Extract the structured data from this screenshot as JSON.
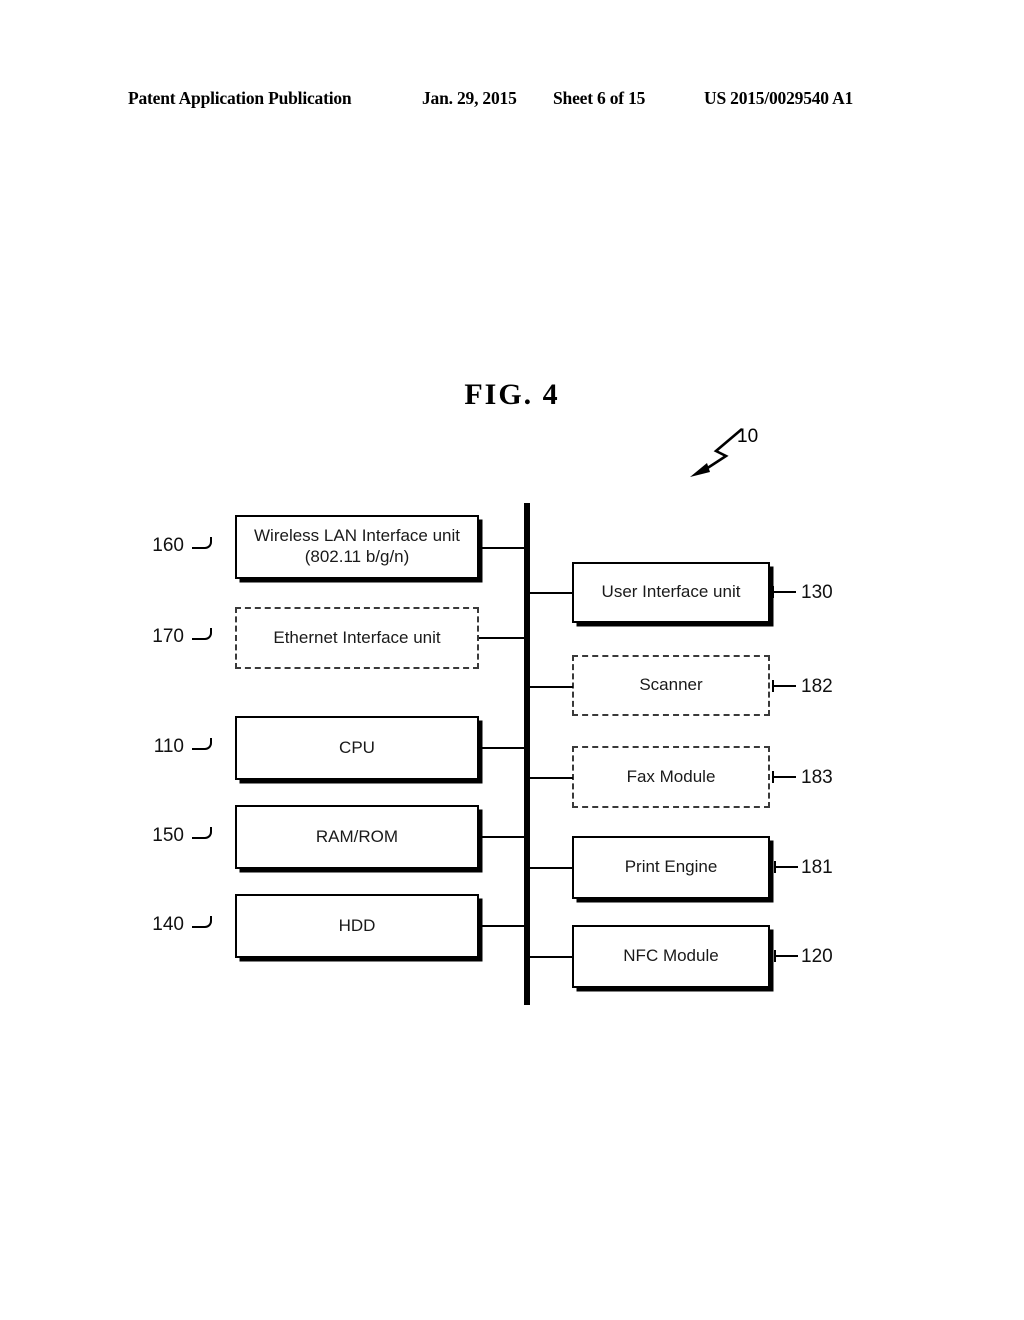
{
  "header": {
    "publication": "Patent Application Publication",
    "date": "Jan. 29, 2015",
    "sheet": "Sheet 6 of 15",
    "document_number": "US 2015/0029540 A1"
  },
  "figure": {
    "title": "FIG.  4",
    "system_ref": "10"
  },
  "diagram": {
    "bus_name": "system-bus",
    "left_blocks": [
      {
        "ref": "160",
        "label": "Wireless LAN Interface unit\n(802.11 b/g/n)",
        "style": "solid"
      },
      {
        "ref": "170",
        "label": "Ethernet Interface unit",
        "style": "dashed"
      },
      {
        "ref": "110",
        "label": "CPU",
        "style": "solid"
      },
      {
        "ref": "150",
        "label": "RAM/ROM",
        "style": "solid"
      },
      {
        "ref": "140",
        "label": "HDD",
        "style": "solid"
      }
    ],
    "right_blocks": [
      {
        "ref": "130",
        "label": "User Interface unit",
        "style": "solid"
      },
      {
        "ref": "182",
        "label": "Scanner",
        "style": "dashed"
      },
      {
        "ref": "183",
        "label": "Fax Module",
        "style": "dashed"
      },
      {
        "ref": "181",
        "label": "Print Engine",
        "style": "solid"
      },
      {
        "ref": "120",
        "label": "NFC Module",
        "style": "solid"
      }
    ]
  }
}
